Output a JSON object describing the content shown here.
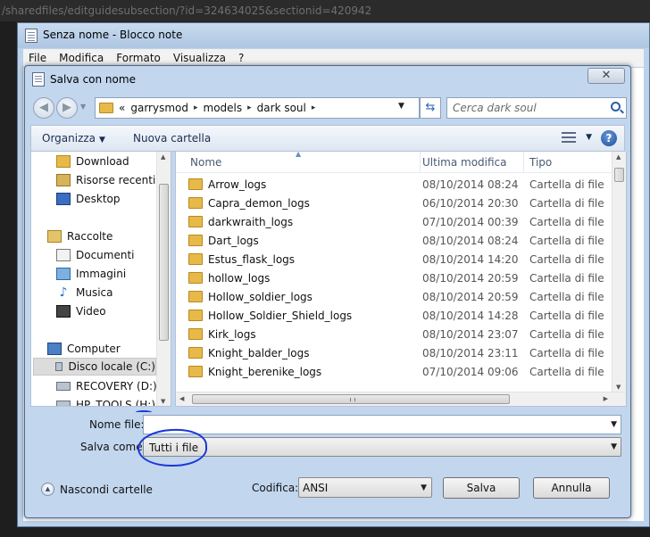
{
  "browser": {
    "url_text": "/sharedfiles/editguidesubsection/?id=324634025&sectionid=420942"
  },
  "notepad": {
    "title": "Senza nome - Blocco note",
    "menu": [
      "File",
      "Modifica",
      "Formato",
      "Visualizza",
      "?"
    ]
  },
  "dialog": {
    "title": "Salva con nome",
    "close_glyph": "✕",
    "breadcrumb": {
      "overflow": "«",
      "parts": [
        "garrysmod",
        "models",
        "dark soul"
      ],
      "separator": "▸"
    },
    "search_placeholder": "Cerca dark soul",
    "toolbar": {
      "organize": "Organizza",
      "new_folder": "Nuova cartella",
      "help": "?"
    },
    "nav": {
      "items": [
        {
          "label": "Download",
          "icon": "download-folder-icon"
        },
        {
          "label": "Risorse recenti",
          "icon": "recent-places-icon"
        },
        {
          "label": "Desktop",
          "icon": "desktop-icon"
        },
        {
          "label": "Raccolte",
          "icon": "libraries-icon"
        },
        {
          "label": "Documenti",
          "icon": "documents-icon"
        },
        {
          "label": "Immagini",
          "icon": "pictures-icon"
        },
        {
          "label": "Musica",
          "icon": "music-icon"
        },
        {
          "label": "Video",
          "icon": "video-icon"
        },
        {
          "label": "Computer",
          "icon": "computer-icon"
        },
        {
          "label": "Disco locale (C:)",
          "icon": "drive-icon",
          "selected": true
        },
        {
          "label": "RECOVERY (D:)",
          "icon": "drive-icon"
        },
        {
          "label": "HP_TOOLS (H:)",
          "icon": "drive-icon"
        }
      ]
    },
    "columns": {
      "name": "Nome",
      "modified": "Ultima modifica",
      "type": "Tipo"
    },
    "files": [
      {
        "name": "Arrow_logs",
        "modified": "08/10/2014 08:24",
        "type": "Cartella di file"
      },
      {
        "name": "Capra_demon_logs",
        "modified": "06/10/2014 20:30",
        "type": "Cartella di file"
      },
      {
        "name": "darkwraith_logs",
        "modified": "07/10/2014 00:39",
        "type": "Cartella di file"
      },
      {
        "name": "Dart_logs",
        "modified": "08/10/2014 08:24",
        "type": "Cartella di file"
      },
      {
        "name": "Estus_flask_logs",
        "modified": "08/10/2014 14:20",
        "type": "Cartella di file"
      },
      {
        "name": "hollow_logs",
        "modified": "08/10/2014 20:59",
        "type": "Cartella di file"
      },
      {
        "name": "Hollow_soldier_logs",
        "modified": "08/10/2014 20:59",
        "type": "Cartella di file"
      },
      {
        "name": "Hollow_Soldier_Shield_logs",
        "modified": "08/10/2014 14:28",
        "type": "Cartella di file"
      },
      {
        "name": "Kirk_logs",
        "modified": "08/10/2014 23:07",
        "type": "Cartella di file"
      },
      {
        "name": "Knight_balder_logs",
        "modified": "08/10/2014 23:11",
        "type": "Cartella di file"
      },
      {
        "name": "Knight_berenike_logs",
        "modified": "07/10/2014 09:06",
        "type": "Cartella di file"
      }
    ],
    "filename": {
      "label": "Nome file:",
      "value": ""
    },
    "save_as": {
      "label": "Salva come:",
      "value": "Tutti i file"
    },
    "hide_folders": "Nascondi cartelle",
    "encoding": {
      "label": "Codifica:",
      "value": "ANSI"
    },
    "buttons": {
      "save": "Salva",
      "cancel": "Annulla"
    },
    "annotation_color": "#1b37d6"
  }
}
